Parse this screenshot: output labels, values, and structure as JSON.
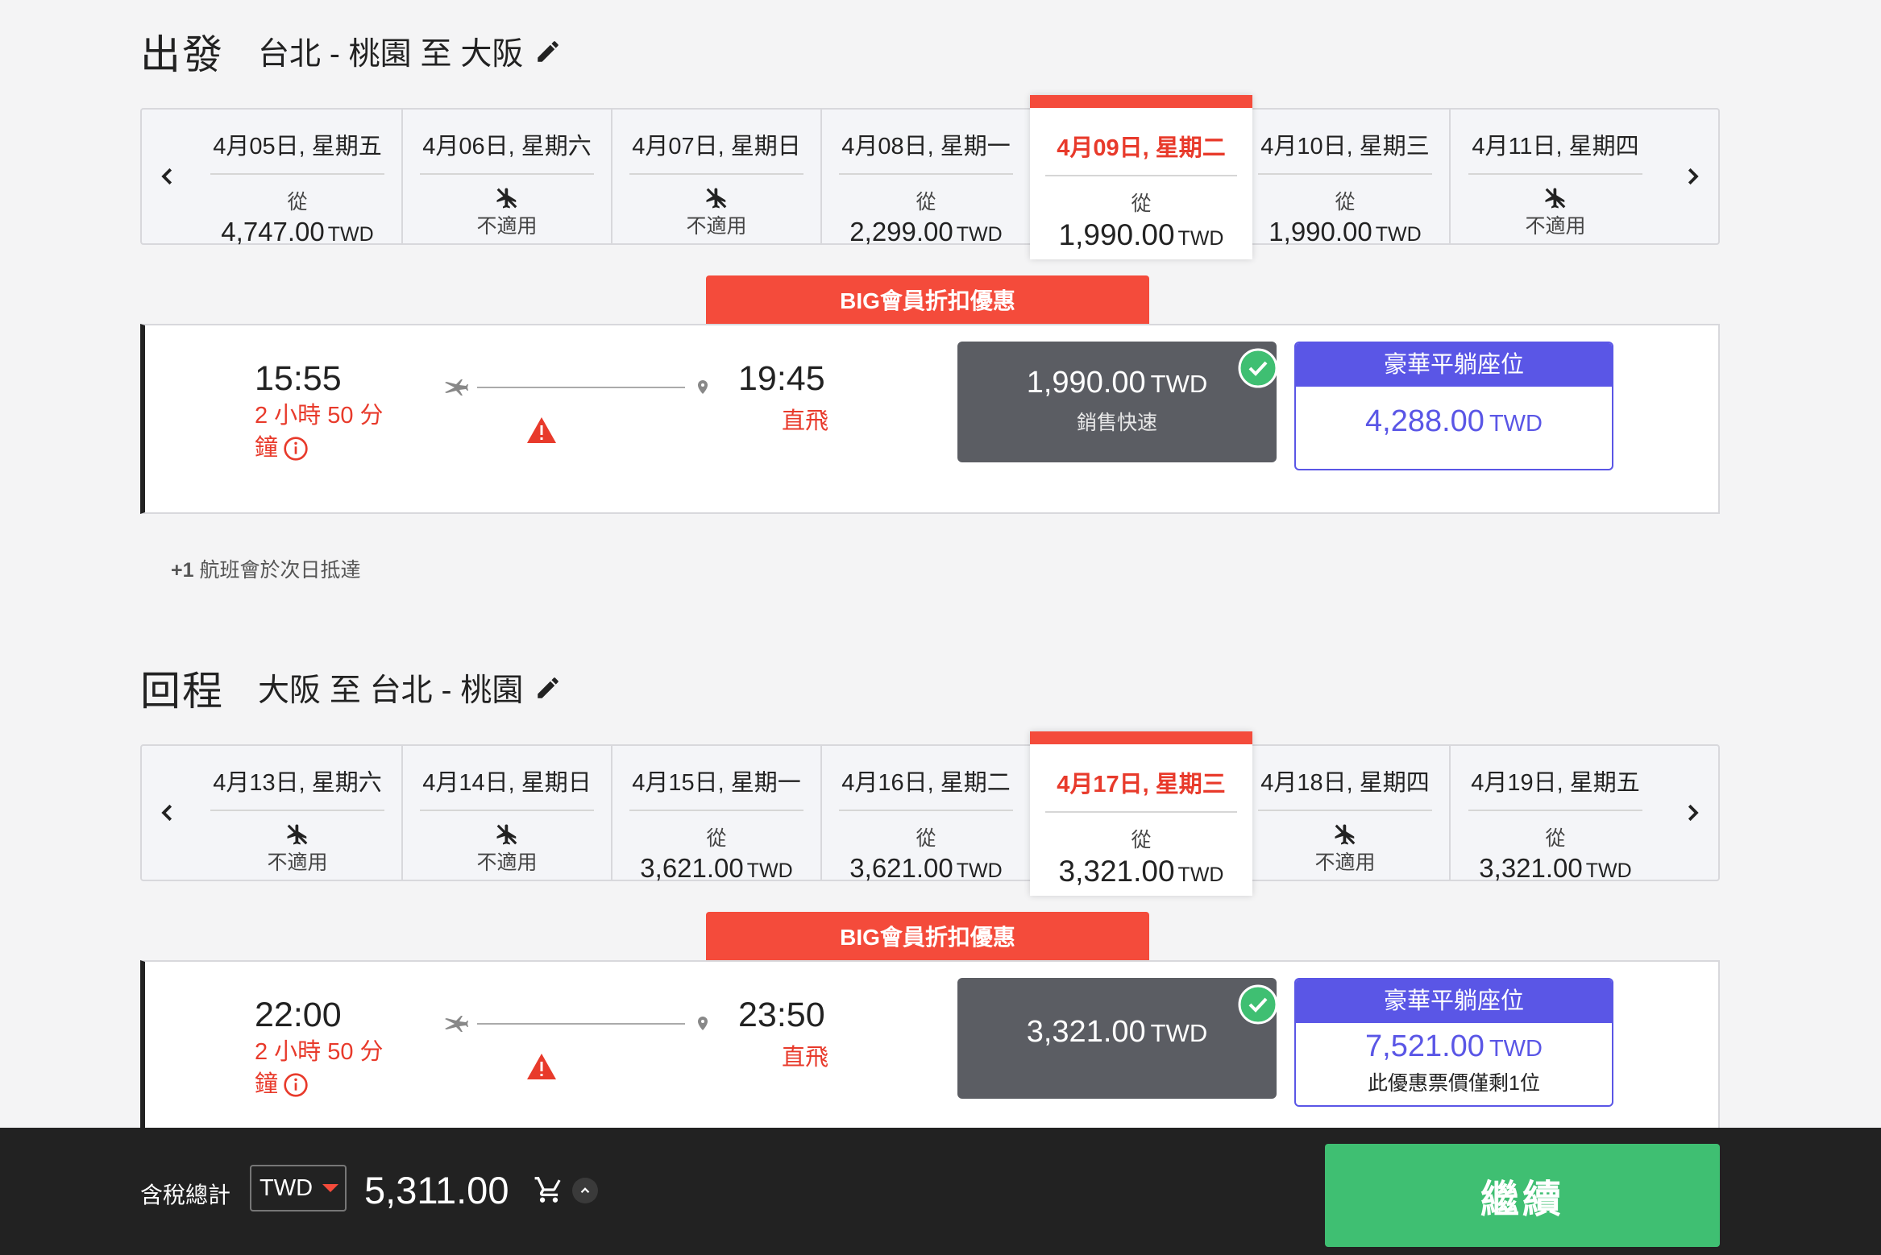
{
  "outbound": {
    "kind": "出發",
    "route": "台北 - 桃園 至 大阪",
    "dates": [
      {
        "label": "4月05日, 星期五",
        "available": true,
        "from": "從",
        "price": "4,747.00",
        "currency": "TWD"
      },
      {
        "label": "4月06日, 星期六",
        "available": false,
        "na_text": "不適用"
      },
      {
        "label": "4月07日, 星期日",
        "available": false,
        "na_text": "不適用"
      },
      {
        "label": "4月08日, 星期一",
        "available": true,
        "from": "從",
        "price": "2,299.00",
        "currency": "TWD"
      },
      {
        "label": "4月09日, 星期二",
        "available": true,
        "from": "從",
        "price": "1,990.00",
        "currency": "TWD",
        "selected": true
      },
      {
        "label": "4月10日, 星期三",
        "available": true,
        "from": "從",
        "price": "1,990.00",
        "currency": "TWD"
      },
      {
        "label": "4月11日, 星期四",
        "available": false,
        "na_text": "不適用"
      }
    ],
    "badge": "BIG會員折扣優惠",
    "flight": {
      "depart_time": "15:55",
      "arrive_time": "19:45",
      "duration": "2 小時 50 分鐘",
      "stops": "直飛",
      "standard_fare": {
        "price": "1,990.00",
        "currency": "TWD",
        "note": "銷售快速",
        "selected": true
      },
      "premium_fare": {
        "title": "豪華平躺座位",
        "price": "4,288.00",
        "currency": "TWD",
        "note": ""
      }
    },
    "next_day_note_prefix": "+1",
    "next_day_note": " 航班會於次日抵達"
  },
  "inbound": {
    "kind": "回程",
    "route": "大阪 至 台北 - 桃園",
    "dates": [
      {
        "label": "4月13日, 星期六",
        "available": false,
        "na_text": "不適用"
      },
      {
        "label": "4月14日, 星期日",
        "available": false,
        "na_text": "不適用"
      },
      {
        "label": "4月15日, 星期一",
        "available": true,
        "from": "從",
        "price": "3,621.00",
        "currency": "TWD"
      },
      {
        "label": "4月16日, 星期二",
        "available": true,
        "from": "從",
        "price": "3,621.00",
        "currency": "TWD"
      },
      {
        "label": "4月17日, 星期三",
        "available": true,
        "from": "從",
        "price": "3,321.00",
        "currency": "TWD",
        "selected": true
      },
      {
        "label": "4月18日, 星期四",
        "available": false,
        "na_text": "不適用"
      },
      {
        "label": "4月19日, 星期五",
        "available": true,
        "from": "從",
        "price": "3,321.00",
        "currency": "TWD"
      }
    ],
    "badge": "BIG會員折扣優惠",
    "flight": {
      "depart_time": "22:00",
      "arrive_time": "23:50",
      "duration": "2 小時 50 分鐘",
      "stops": "直飛",
      "standard_fare": {
        "price": "3,321.00",
        "currency": "TWD",
        "note": "",
        "selected": true
      },
      "premium_fare": {
        "title": "豪華平躺座位",
        "price": "7,521.00",
        "currency": "TWD",
        "note": "此優惠票價僅剩1位"
      }
    }
  },
  "footer": {
    "total_label": "含稅總計",
    "currency": "TWD",
    "total": "5,311.00",
    "continue": "繼續"
  },
  "colors": {
    "accent_red": "#f44b3b",
    "premium_purple": "#5a56e6",
    "continue_green": "#3fbf72",
    "selected_fare_gray": "#5b5d63"
  },
  "icons": [
    "pencil-icon",
    "chevron-left-icon",
    "chevron-right-icon",
    "plane-unavailable-icon",
    "plane-icon",
    "pin-icon",
    "warning-icon",
    "info-icon",
    "check-icon",
    "cart-icon",
    "chevron-up-icon"
  ]
}
